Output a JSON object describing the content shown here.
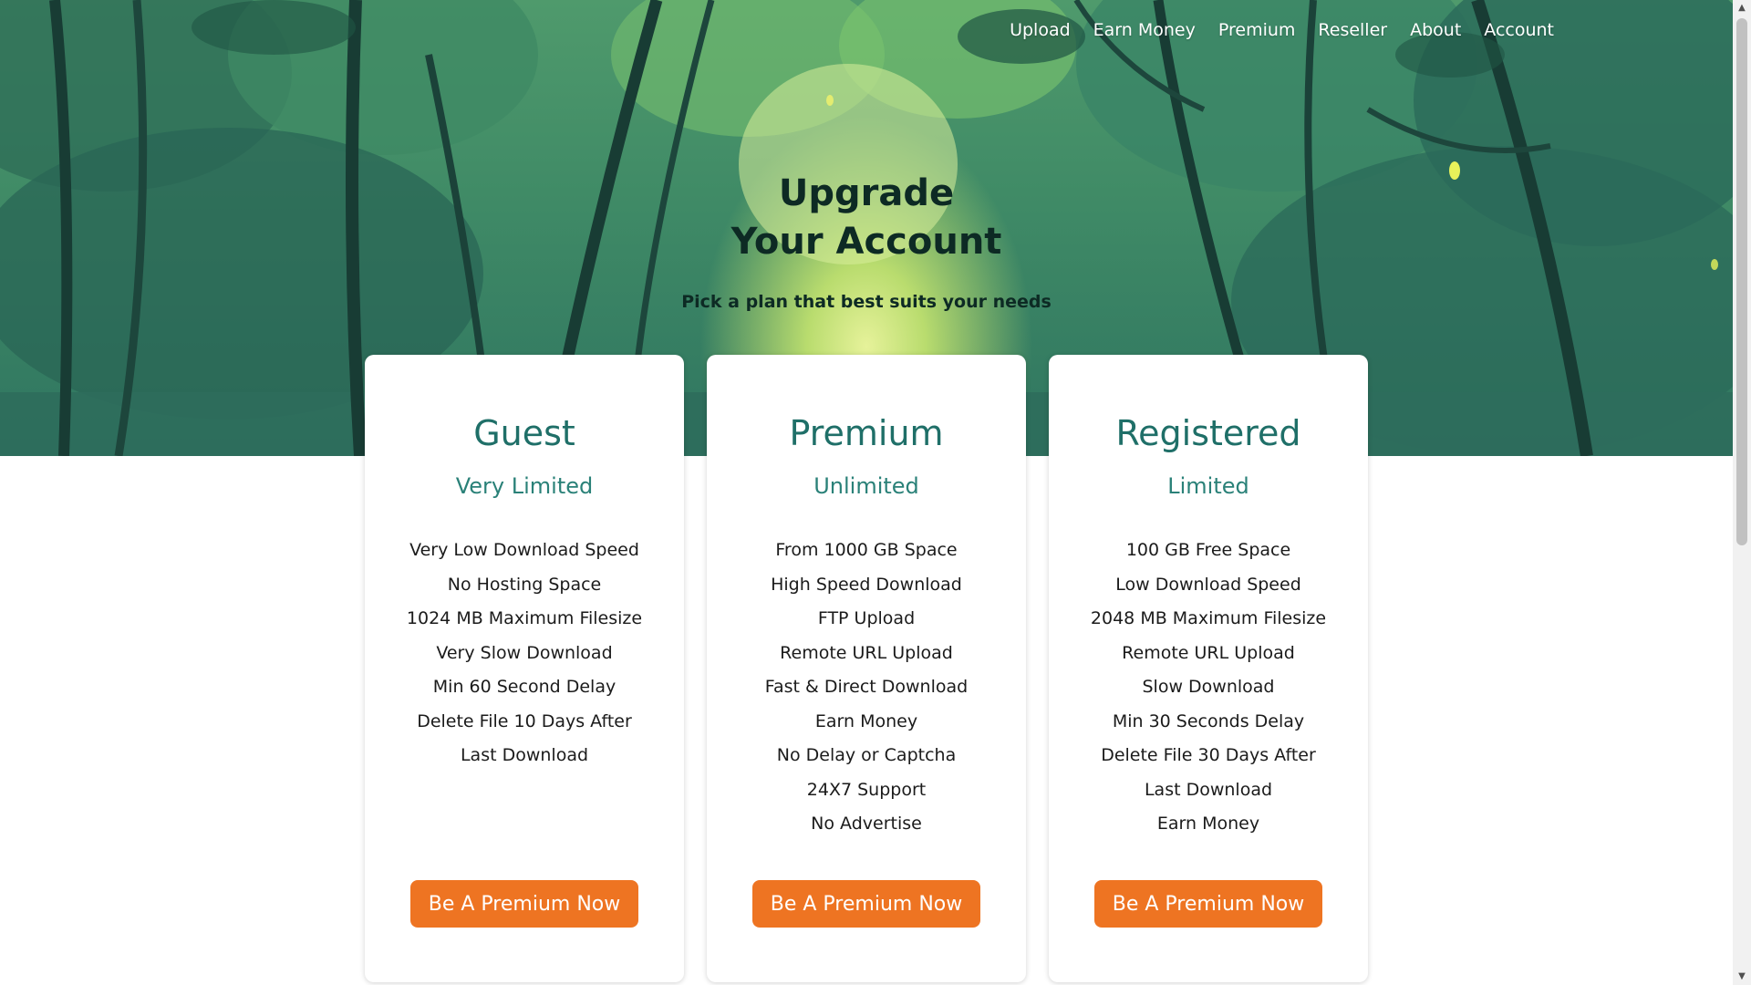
{
  "nav": {
    "items": [
      "Upload",
      "Earn Money",
      "Premium",
      "Reseller",
      "About",
      "Account"
    ]
  },
  "hero": {
    "title_line1": "Upgrade",
    "title_line2": "Your Account",
    "subtitle": "Pick a plan that best suits your needs"
  },
  "plans": [
    {
      "name": "Guest",
      "tier": "Very Limited",
      "features": [
        "Very Low Download Speed",
        "No Hosting Space",
        "1024 MB Maximum Filesize",
        "Very Slow Download",
        "Min 60 Second Delay",
        "Delete File 10 Days After",
        "Last Download"
      ],
      "button": "Be A Premium Now"
    },
    {
      "name": "Premium",
      "tier": "Unlimited",
      "features": [
        "From 1000 GB Space",
        "High Speed Download",
        "FTP Upload",
        "Remote URL Upload",
        "Fast & Direct Download",
        "Earn Money",
        "No Delay or Captcha",
        "24X7 Support",
        "No Advertise"
      ],
      "button": "Be A Premium Now"
    },
    {
      "name": "Registered",
      "tier": "Limited",
      "features": [
        "100 GB Free Space",
        "Low Download Speed",
        "2048 MB Maximum Filesize",
        "Remote URL Upload",
        "Slow Download",
        "Min 30 Seconds Delay",
        "Delete File 30 Days After",
        "Last Download",
        "Earn Money"
      ],
      "button": "Be A Premium Now"
    }
  ],
  "colors": {
    "accent_button": "#ee7422",
    "plan_title": "#1f6f68",
    "hero_text": "#0d2a24"
  },
  "icons": {
    "scroll_up": "triangle-up",
    "scroll_down": "triangle-down"
  }
}
